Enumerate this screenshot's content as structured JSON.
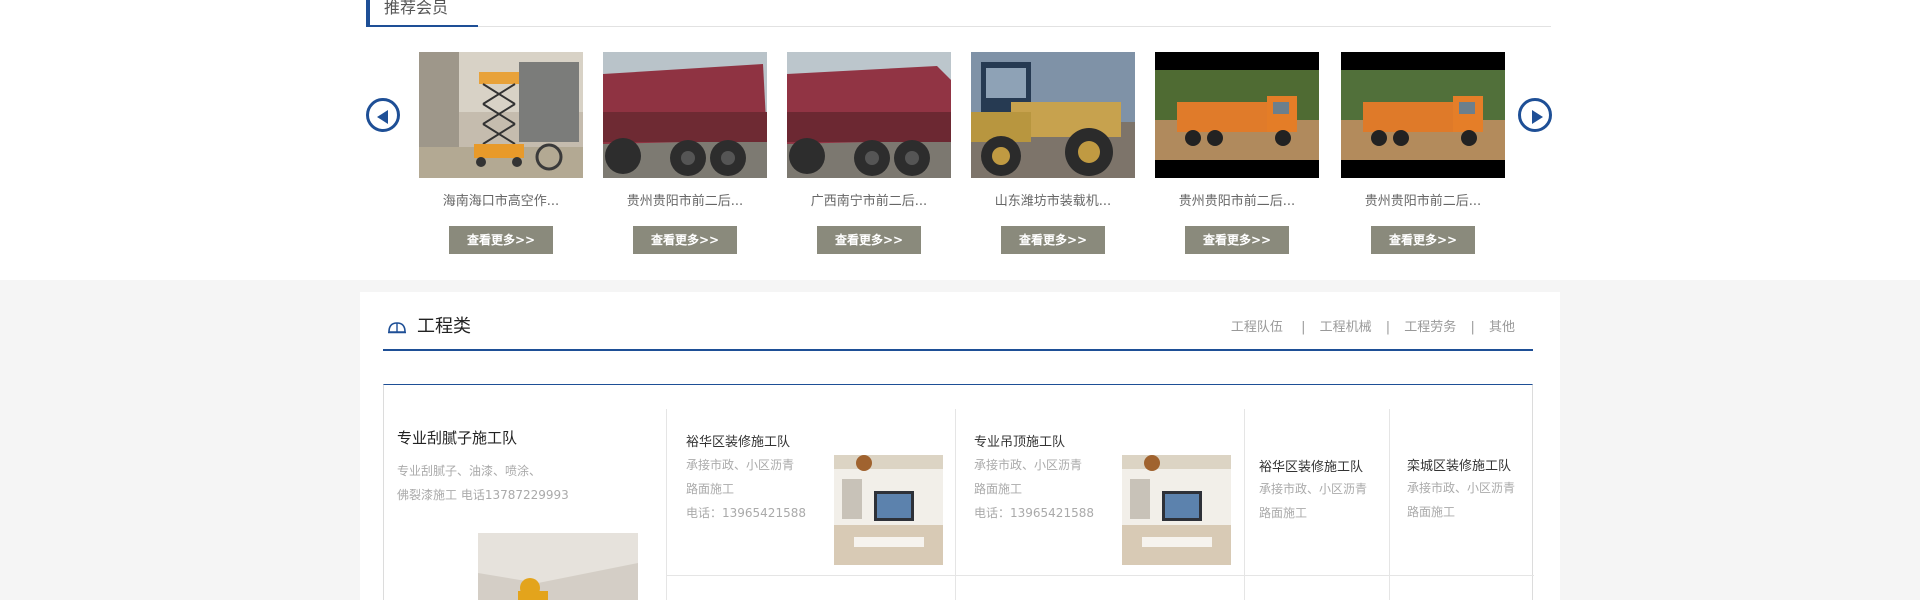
{
  "recommended": {
    "title": "推荐会员",
    "prev_icon": "arrow-left-icon",
    "next_icon": "arrow-right-icon",
    "members": [
      {
        "name": "海南海口市高空作...",
        "more": "查看更多>>",
        "photo": "scissor-lift"
      },
      {
        "name": "贵州贵阳市前二后...",
        "more": "查看更多>>",
        "photo": "red-dump-truck"
      },
      {
        "name": "广西南宁市前二后...",
        "more": "查看更多>>",
        "photo": "red-dump-truck"
      },
      {
        "name": "山东潍坊市装载机...",
        "more": "查看更多>>",
        "photo": "wheel-loader"
      },
      {
        "name": "贵州贵阳市前二后...",
        "more": "查看更多>>",
        "photo": "orange-dump-truck"
      },
      {
        "name": "贵州贵阳市前二后...",
        "more": "查看更多>>",
        "photo": "orange-dump-truck"
      }
    ]
  },
  "engineering": {
    "icon": "hard-hat-icon",
    "title": "工程类",
    "nav": [
      "工程队伍",
      "工程机械",
      "工程劳务",
      "其他"
    ],
    "featured": {
      "title": "专业刮腻子施工队",
      "desc_line1": "专业刮腻子、油漆、喷涂、",
      "desc_line2": "佛裂漆施工 电话13787229993"
    },
    "cards": [
      {
        "title": "裕华区装修施工队",
        "desc_line1": "承接市政、小区沥青",
        "desc_line2": "路面施工",
        "phone": "电话：13965421588"
      },
      {
        "title": "专业吊顶施工队",
        "desc_line1": "承接市政、小区沥青",
        "desc_line2": "路面施工",
        "phone": "电话：13965421588"
      },
      {
        "title": "裕华区装修施工队",
        "desc_line1": "承接市政、小区沥青",
        "desc_line2": "路面施工"
      },
      {
        "title": "栾城区装修施工队",
        "desc_line1": "承接市政、小区沥青",
        "desc_line2": "路面施工"
      }
    ]
  },
  "colors": {
    "accent": "#1e4f96",
    "button": "#8a8a7c",
    "section_bg": "#f5f5f5"
  }
}
